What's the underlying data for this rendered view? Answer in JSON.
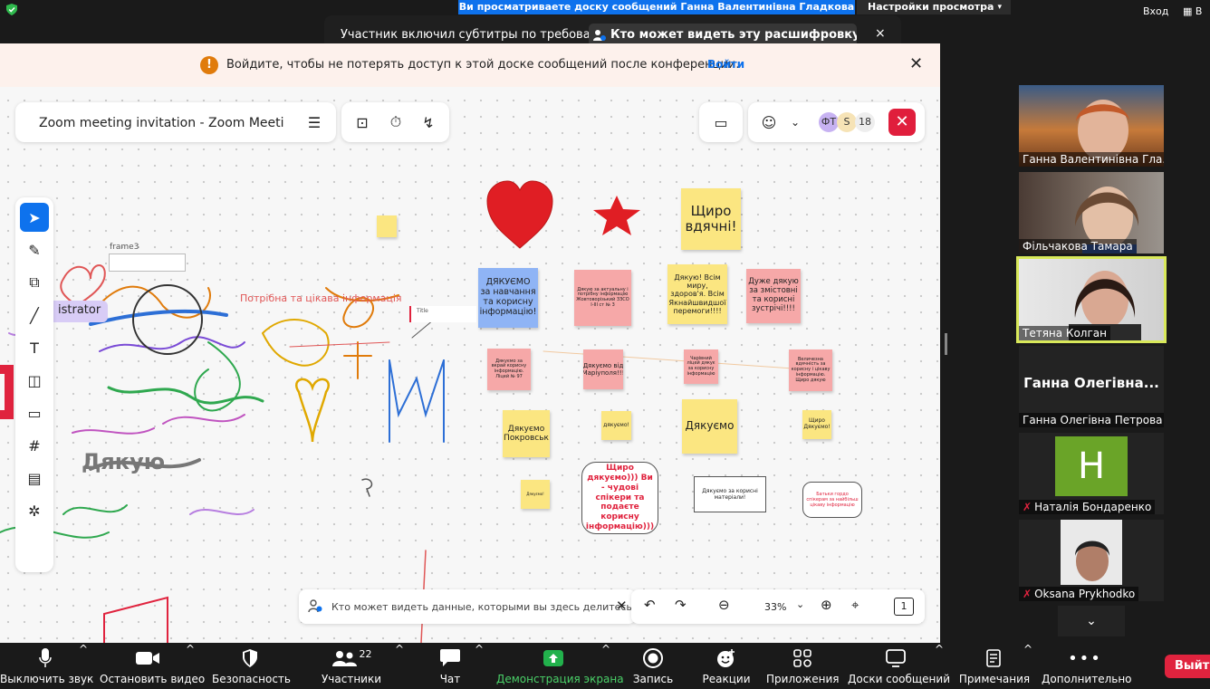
{
  "top_bar": {
    "viewing_banner": "Ви просматриваете доску сообщений Ганна Валентинівна Гладкова",
    "view_settings": "Настройки просмотра",
    "exit_label": "Вход"
  },
  "toast": {
    "message": "Участник включил субтитры по требованию",
    "link_text": "Кто может видеть эту расшифровку? За...",
    "close": "×"
  },
  "signin_banner": {
    "text": "Войдите, чтобы не потерять доступ к этой доске сообщений после конференции.",
    "link": "Войти",
    "close": "✕"
  },
  "whiteboard": {
    "title": "Zoom meeting invitation - Zoom Meeting...",
    "participant_chips": [
      "ФТ",
      "S"
    ],
    "participant_count": "18",
    "frame_label": "frame3",
    "admin_label": "istrator",
    "doodle_text_1": "Дякую",
    "sketch_note": "Потрібна та цікава інформація",
    "small_box_label": "Title",
    "big_sign": "Щиро вдячні!",
    "stickies": [
      {
        "text": "ДЯКУЄМО за навчання та корисну інформацію!"
      },
      {
        "text": "Дякую за актуальну і потрібну інформацію Жовтоворізький ЗЗСО І-ІІІ ст № 3"
      },
      {
        "text": "Дякую! Всім миру, здоров'я. Всім Якнайшвидшої перемоги!!!!"
      },
      {
        "text": "Дуже дякую за змістовні та корисні зустрічі!!!!"
      },
      {
        "text": "Дякуємо за вкрай корисну інформацію. Ліцей № 97"
      },
      {
        "text": "Дякуємо від Маріуполя!!!"
      },
      {
        "text": "Чарівний ліцей дякує за корисну інформацію"
      },
      {
        "text": "Величезна вдячність за корисну і цікаву інформацію. Щиро дякую"
      },
      {
        "text": "Дякуємо Покровськ"
      },
      {
        "text": "дякуємо!"
      },
      {
        "text": "Дякуємо"
      },
      {
        "text": "Щиро Дякуємо!"
      },
      {
        "text": "Дякуємо!"
      }
    ],
    "boxes": [
      {
        "text": "Щиро дякуємо))) Ви - чудові спікери та подаєте корисну інформацію)))"
      },
      {
        "text": "Дякуємо за корисні матеріали!"
      },
      {
        "text": "Батьки гордо спікерам за найбільш цікаву інформацію"
      }
    ]
  },
  "privacy_notice": {
    "text": "Кто может видеть данные, которыми вы здесь делитесь"
  },
  "zoom_controls": {
    "zoom_level": "33%",
    "page_count": "1"
  },
  "participants": [
    {
      "name": "Ганна Валентинівна Гла...",
      "muted": false
    },
    {
      "name": "Фільчакова Тамара",
      "muted": false
    },
    {
      "name": "Тетяна Колган",
      "muted": false,
      "active": true
    },
    {
      "name": "Ганна Олегівна Петрова",
      "display": "Ганна  Олегівна...",
      "muted": false
    },
    {
      "name": "Наталія Бондаренко",
      "initial": "H",
      "muted": true
    },
    {
      "name": "Oksana Prykhodko",
      "muted": true
    }
  ],
  "bottom_bar": {
    "mute": "Выключить звук",
    "video": "Остановить видео",
    "security": "Безопасность",
    "participants": "Участники",
    "participants_count": "22",
    "chat": "Чат",
    "share": "Демонстрация экрана",
    "record": "Запись",
    "reactions": "Реакции",
    "apps": "Приложения",
    "whiteboards": "Доски сообщений",
    "notes": "Примечания",
    "more": "Дополнительно",
    "end": "Выйти"
  },
  "colors": {
    "accent": "#0e72ed",
    "danger": "#e01e3c",
    "sticky_yellow": "#fbe681",
    "sticky_pink": "#f6a8a8",
    "sticky_blue": "#8fb4f5",
    "share_green": "#4ad068"
  }
}
